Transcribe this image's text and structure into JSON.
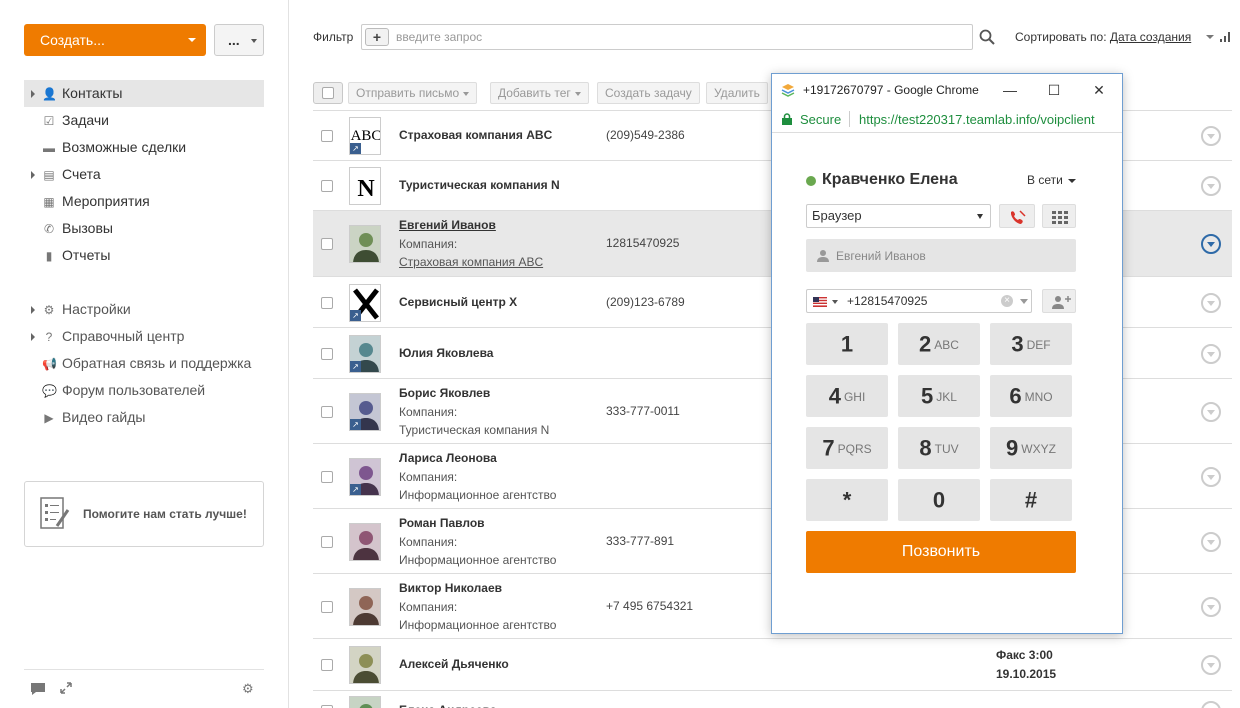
{
  "sidebar": {
    "create_label": "Создать...",
    "more_label": "...",
    "nav": [
      {
        "label": "Контакты",
        "icon": "contacts-icon",
        "glyph": "👤",
        "has_arrow": true,
        "active": true
      },
      {
        "label": "Задачи",
        "icon": "tasks-icon",
        "glyph": "☑",
        "has_arrow": false
      },
      {
        "label": "Возможные сделки",
        "icon": "deals-icon",
        "glyph": "▬",
        "has_arrow": false
      },
      {
        "label": "Счета",
        "icon": "invoices-icon",
        "glyph": "▤",
        "has_arrow": true
      },
      {
        "label": "Мероприятия",
        "icon": "calendar-icon",
        "glyph": "▦",
        "has_arrow": false
      },
      {
        "label": "Вызовы",
        "icon": "phone-icon",
        "glyph": "✆",
        "has_arrow": false
      },
      {
        "label": "Отчеты",
        "icon": "reports-icon",
        "glyph": "▮",
        "has_arrow": false
      }
    ],
    "nav2": [
      {
        "label": "Настройки",
        "icon": "gear-icon",
        "glyph": "⚙",
        "has_arrow": true
      },
      {
        "label": "Справочный центр",
        "icon": "help-icon",
        "glyph": "?",
        "has_arrow": true
      },
      {
        "label": "Обратная связь и поддержка",
        "icon": "megaphone-icon",
        "glyph": "📢",
        "has_arrow": false
      },
      {
        "label": "Форум пользователей",
        "icon": "forum-icon",
        "glyph": "💬",
        "has_arrow": false
      },
      {
        "label": "Видео гайды",
        "icon": "video-icon",
        "glyph": "▶",
        "has_arrow": false
      }
    ],
    "feedback_text": "Помогите нам стать лучше!"
  },
  "filter": {
    "label": "Фильтр",
    "placeholder": "введите запрос",
    "sort_label": "Сортировать по:",
    "sort_value": "Дата создания"
  },
  "toolbar": {
    "send_email": "Отправить письмо",
    "add_tag": "Добавить тег",
    "create_task": "Создать задачу",
    "delete": "Удалить"
  },
  "contacts": [
    {
      "name": "Страховая компания ABC",
      "phone": "(209)549-2386",
      "avatar": "ABC",
      "company": true,
      "badge": true
    },
    {
      "name": "Туристическая компания N",
      "phone": "",
      "avatar": "N",
      "company": true,
      "badge": false
    },
    {
      "name": "Евгений Иванов",
      "phone": "12815470925",
      "avatar": "photo",
      "company_label": "Компания:",
      "company_name": "Страховая компания ABC",
      "selected": true,
      "link": true
    },
    {
      "name": "Сервисный центр X",
      "phone": "(209)123-6789",
      "avatar": "X",
      "company": true,
      "badge": true
    },
    {
      "name": "Юлия Яковлева",
      "phone": "",
      "avatar": "photo",
      "badge": true
    },
    {
      "name": "Борис Яковлев",
      "phone": "333-777-0011",
      "avatar": "photo",
      "company_label": "Компания:",
      "company_name": "Туристическая компания N",
      "badge": true
    },
    {
      "name": "Лариса Леонова",
      "phone": "",
      "avatar": "photo",
      "company_label": "Компания:",
      "company_name": "Информационное агентство",
      "badge": true
    },
    {
      "name": "Роман Павлов",
      "phone": "333-777-891",
      "avatar": "photo",
      "company_label": "Компания:",
      "company_name": "Информационное агентство"
    },
    {
      "name": "Виктор Николаев",
      "phone": "+7 495 6754321",
      "avatar": "photo",
      "company_label": "Компания:",
      "company_name": "Информационное агентство"
    },
    {
      "name": "Алексей Дьяченко",
      "phone": "",
      "avatar": "photo",
      "extra1": "Факс 3:00",
      "extra2": "19.10.2015"
    },
    {
      "name": "Елена Андреева",
      "phone": "",
      "avatar": "photo"
    }
  ],
  "popup": {
    "window_title": "+19172670797 - Google Chrome",
    "secure_label": "Secure",
    "url": "https://test220317.teamlab.info/voipclient",
    "agent_name": "Кравченко Елена",
    "status": "В сети",
    "device": "Браузер",
    "contact_placeholder": "Евгений Иванов",
    "phone_number": "+12815470925",
    "keys": [
      {
        "digit": "1",
        "letters": ""
      },
      {
        "digit": "2",
        "letters": "ABC"
      },
      {
        "digit": "3",
        "letters": "DEF"
      },
      {
        "digit": "4",
        "letters": "GHI"
      },
      {
        "digit": "5",
        "letters": "JKL"
      },
      {
        "digit": "6",
        "letters": "MNO"
      },
      {
        "digit": "7",
        "letters": "PQRS"
      },
      {
        "digit": "8",
        "letters": "TUV"
      },
      {
        "digit": "9",
        "letters": "WXYZ"
      },
      {
        "digit": "*",
        "letters": ""
      },
      {
        "digit": "0",
        "letters": ""
      },
      {
        "digit": "#",
        "letters": ""
      }
    ],
    "call_label": "Позвонить"
  },
  "colors": {
    "accent": "#ef7b00",
    "online": "#6aa84f",
    "secure": "#1e8e3e",
    "selected_row": "#e8e8e8"
  }
}
